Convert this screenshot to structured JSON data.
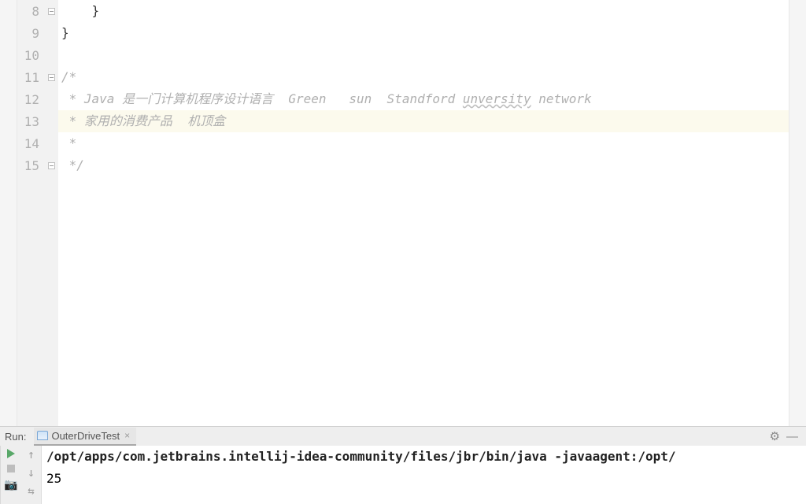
{
  "editor": {
    "lines": [
      {
        "num": 8,
        "fold": "minus",
        "content": "    }",
        "cls": ""
      },
      {
        "num": 9,
        "fold": "",
        "content": "}",
        "cls": ""
      },
      {
        "num": 10,
        "fold": "",
        "content": "",
        "cls": ""
      },
      {
        "num": 11,
        "fold": "minus",
        "content": "/*",
        "cls": "comment"
      },
      {
        "num": 12,
        "fold": "",
        "content": " * Java 是一门计算机程序设计语言  Green   sun  Standford unversity network",
        "cls": "comment",
        "wavyWord": "unversity"
      },
      {
        "num": 13,
        "fold": "",
        "content": " * 家用的消费产品  机顶盒",
        "cls": "comment",
        "highlight": true
      },
      {
        "num": 14,
        "fold": "",
        "content": " *",
        "cls": "comment"
      },
      {
        "num": 15,
        "fold": "minus",
        "content": " */",
        "cls": "comment"
      }
    ]
  },
  "run": {
    "label": "Run:",
    "tab_name": "OuterDriveTest"
  },
  "console": {
    "line1": "/opt/apps/com.jetbrains.intellij-idea-community/files/jbr/bin/java -javaagent:/opt/",
    "line2": "25"
  }
}
